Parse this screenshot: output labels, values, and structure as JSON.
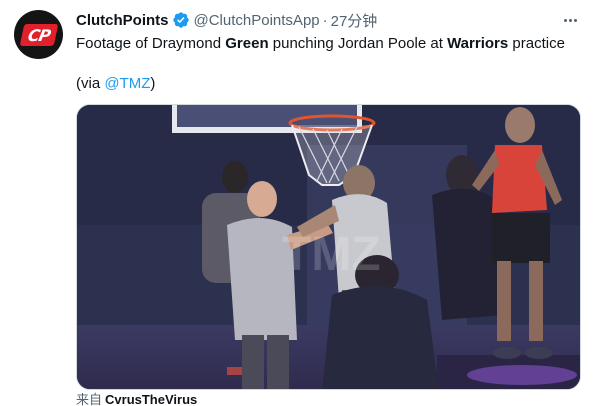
{
  "account": {
    "display_name": "ClutchPoints",
    "handle": "@ClutchPointsApp",
    "separator": "·",
    "time": "27分钟",
    "avatar_text": "CP"
  },
  "tweet": {
    "text_1": "Footage of Draymond ",
    "hl_1": "Green",
    "text_2": " punching Jordan Poole at ",
    "hl_2": "Warriors",
    "text_3": " practice",
    "via_open": "(via ",
    "via_handle": "@TMZ",
    "via_close": ")"
  },
  "media": {
    "kind": "video-still",
    "watermark": "TMZ"
  },
  "attribution": {
    "prefix": "来自",
    "source": "CvrusTheVirus"
  },
  "colors": {
    "link": "#1d9bf0",
    "verified": "#1d9bf0",
    "secondary_text": "#536471",
    "brand_red": "#e0202a"
  }
}
